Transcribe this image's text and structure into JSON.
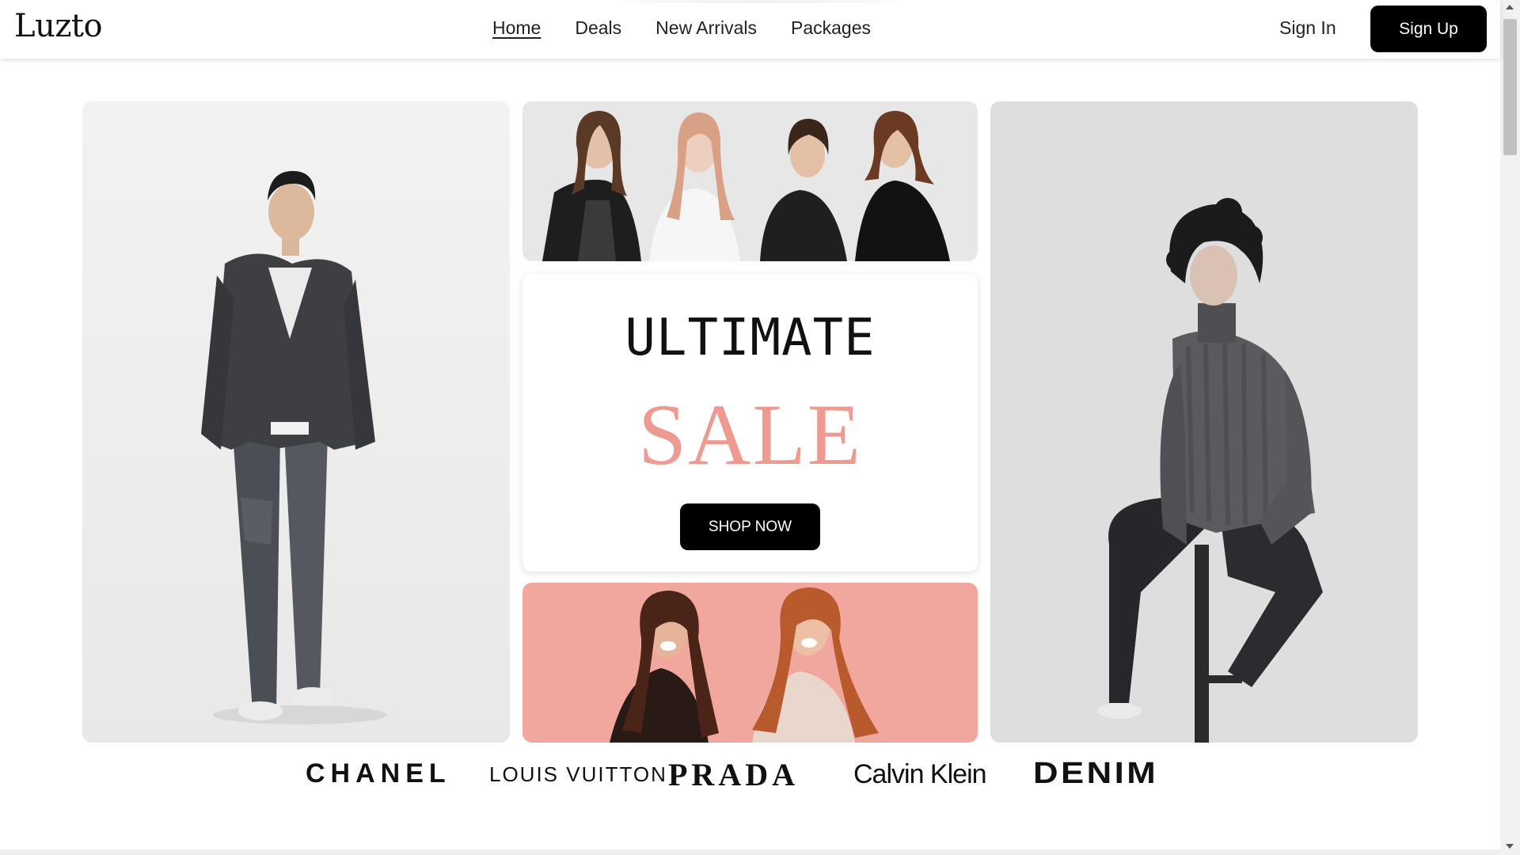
{
  "brand": {
    "logo": "Luzto"
  },
  "nav": {
    "items": [
      {
        "label": "Home",
        "active": true
      },
      {
        "label": "Deals",
        "active": false
      },
      {
        "label": "New Arrivals",
        "active": false
      },
      {
        "label": "Packages",
        "active": false
      }
    ]
  },
  "auth": {
    "sign_in": "Sign In",
    "sign_up": "Sign Up"
  },
  "hero": {
    "headline": "ULTIMATE",
    "accent_word": "SALE",
    "cta": "SHOP NOW",
    "accent_color": "#ee9a91",
    "photos": {
      "left": "man-in-jacket-and-jeans",
      "right": "man-in-turtleneck-sitting",
      "top": "four-women-group",
      "bottom": "two-laughing-women-on-pink"
    }
  },
  "brands": [
    "CHANEL",
    "LOUIS VUITTON",
    "PRADA",
    "Calvin Klein",
    "DENIM"
  ],
  "colors": {
    "primary_button": "#000000",
    "background": "#ffffff",
    "pink_panel": "#f2a79e"
  }
}
